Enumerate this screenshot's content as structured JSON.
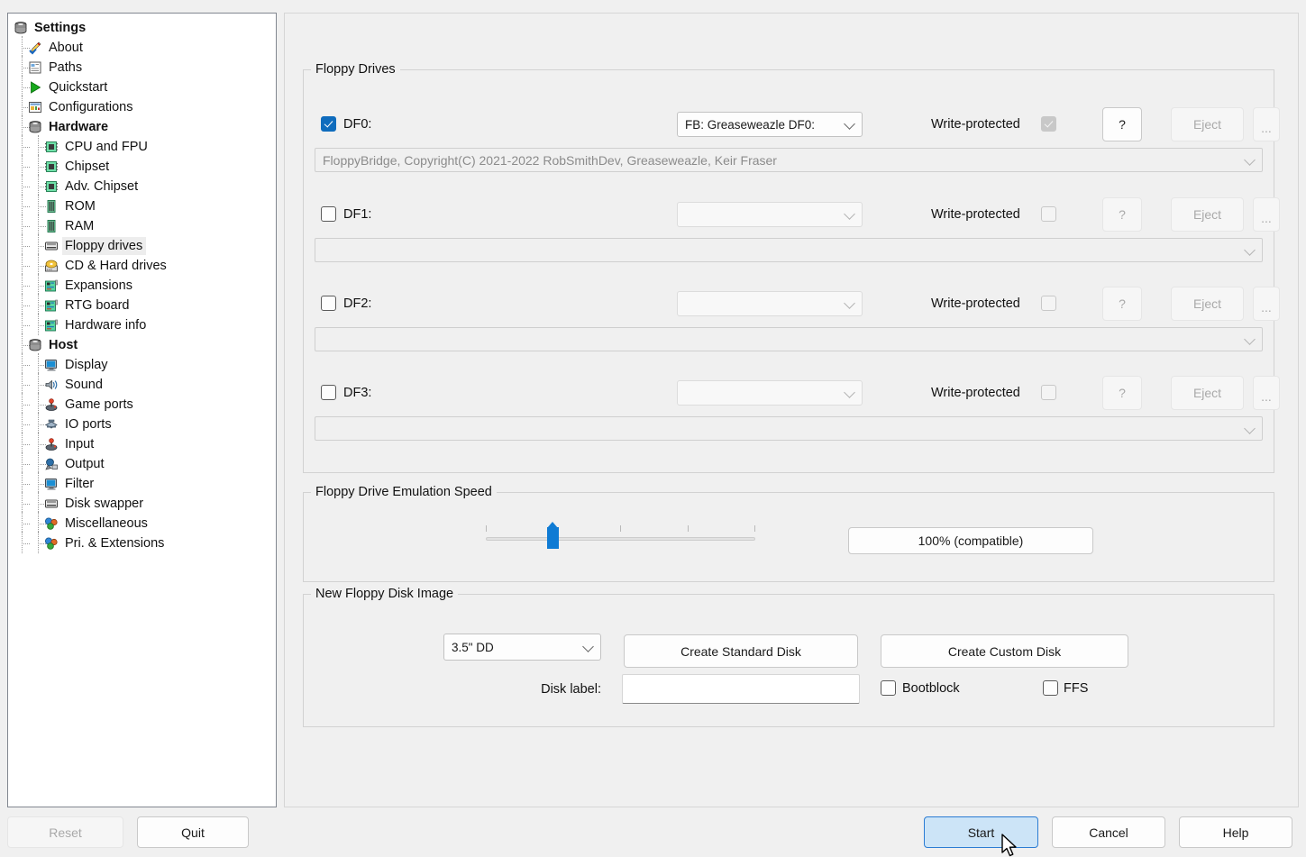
{
  "sidebar": {
    "title": "Settings",
    "items": [
      {
        "label": "Settings",
        "icon": "disk-stack-icon",
        "level": 0,
        "bold": true,
        "selected": false
      },
      {
        "label": "About",
        "icon": "pencil-icon",
        "level": 1,
        "bold": false,
        "selected": false
      },
      {
        "label": "Paths",
        "icon": "paths-icon",
        "level": 1,
        "bold": false,
        "selected": false
      },
      {
        "label": "Quickstart",
        "icon": "play-icon",
        "level": 1,
        "bold": false,
        "selected": false
      },
      {
        "label": "Configurations",
        "icon": "config-icon",
        "level": 1,
        "bold": false,
        "selected": false
      },
      {
        "label": "Hardware",
        "icon": "disk-stack-icon",
        "level": 1,
        "bold": true,
        "selected": false
      },
      {
        "label": "CPU and FPU",
        "icon": "chip-icon",
        "level": 2,
        "bold": false,
        "selected": false
      },
      {
        "label": "Chipset",
        "icon": "chip-icon",
        "level": 2,
        "bold": false,
        "selected": false
      },
      {
        "label": "Adv. Chipset",
        "icon": "chip-icon",
        "level": 2,
        "bold": false,
        "selected": false
      },
      {
        "label": "ROM",
        "icon": "memory-icon",
        "level": 2,
        "bold": false,
        "selected": false
      },
      {
        "label": "RAM",
        "icon": "memory-icon",
        "level": 2,
        "bold": false,
        "selected": false
      },
      {
        "label": "Floppy drives",
        "icon": "floppy-icon",
        "level": 2,
        "bold": false,
        "selected": true
      },
      {
        "label": "CD & Hard drives",
        "icon": "cd-hdd-icon",
        "level": 2,
        "bold": false,
        "selected": false
      },
      {
        "label": "Expansions",
        "icon": "board-icon",
        "level": 2,
        "bold": false,
        "selected": false
      },
      {
        "label": "RTG board",
        "icon": "board-icon",
        "level": 2,
        "bold": false,
        "selected": false
      },
      {
        "label": "Hardware info",
        "icon": "board-icon",
        "level": 2,
        "bold": false,
        "selected": false
      },
      {
        "label": "Host",
        "icon": "disk-stack-icon",
        "level": 1,
        "bold": true,
        "selected": false
      },
      {
        "label": "Display",
        "icon": "monitor-icon",
        "level": 2,
        "bold": false,
        "selected": false
      },
      {
        "label": "Sound",
        "icon": "sound-icon",
        "level": 2,
        "bold": false,
        "selected": false
      },
      {
        "label": "Game ports",
        "icon": "joystick-icon",
        "level": 2,
        "bold": false,
        "selected": false
      },
      {
        "label": "IO ports",
        "icon": "ioports-icon",
        "level": 2,
        "bold": false,
        "selected": false
      },
      {
        "label": "Input",
        "icon": "joystick-icon",
        "level": 2,
        "bold": false,
        "selected": false
      },
      {
        "label": "Output",
        "icon": "output-icon",
        "level": 2,
        "bold": false,
        "selected": false
      },
      {
        "label": "Filter",
        "icon": "monitor-icon",
        "level": 2,
        "bold": false,
        "selected": false
      },
      {
        "label": "Disk swapper",
        "icon": "floppy-icon",
        "level": 2,
        "bold": false,
        "selected": false
      },
      {
        "label": "Miscellaneous",
        "icon": "spheres-icon",
        "level": 2,
        "bold": false,
        "selected": false
      },
      {
        "label": "Pri. & Extensions",
        "icon": "spheres-icon",
        "level": 2,
        "bold": false,
        "selected": false
      }
    ]
  },
  "floppy_drives": {
    "group_title": "Floppy Drives",
    "write_protected_label": "Write-protected",
    "help_label": "?",
    "eject_label": "Eject",
    "browse_label": "...",
    "drives": [
      {
        "name": "DF0:",
        "enabled": true,
        "type_value": "FB: Greaseweazle DF0:",
        "path_value": "FloppyBridge, Copyright(C) 2021-2022 RobSmithDev, Greaseweazle, Keir Fraser",
        "write_protected": true,
        "write_protected_disabled": true,
        "help_enabled": true,
        "eject_enabled": false,
        "browse_enabled": false
      },
      {
        "name": "DF1:",
        "enabled": false,
        "type_value": "",
        "path_value": "",
        "write_protected": false,
        "write_protected_disabled": false,
        "help_enabled": false,
        "eject_enabled": false,
        "browse_enabled": false
      },
      {
        "name": "DF2:",
        "enabled": false,
        "type_value": "",
        "path_value": "",
        "write_protected": false,
        "write_protected_disabled": false,
        "help_enabled": false,
        "eject_enabled": false,
        "browse_enabled": false
      },
      {
        "name": "DF3:",
        "enabled": false,
        "type_value": "",
        "path_value": "",
        "write_protected": false,
        "write_protected_disabled": false,
        "help_enabled": false,
        "eject_enabled": false,
        "browse_enabled": false
      }
    ]
  },
  "emulation_speed": {
    "group_title": "Floppy Drive Emulation Speed",
    "value_label": "100% (compatible)",
    "slider_ticks": 5,
    "slider_position_index": 1,
    "slider_min": 0,
    "slider_max": 4
  },
  "new_disk_image": {
    "group_title": "New Floppy Disk Image",
    "format_value": "3.5\" DD",
    "create_standard_label": "Create Standard Disk",
    "create_custom_label": "Create Custom Disk",
    "disk_label_caption": "Disk label:",
    "disk_label_value": "",
    "bootblock_label": "Bootblock",
    "bootblock_checked": false,
    "ffs_label": "FFS",
    "ffs_checked": false
  },
  "footer": {
    "reset_label": "Reset",
    "reset_enabled": false,
    "quit_label": "Quit",
    "start_label": "Start",
    "cancel_label": "Cancel",
    "help_label": "Help"
  },
  "colors": {
    "accent": "#0f6cbd",
    "primary_button_bg": "#cce4f7",
    "primary_button_border": "#2b7cd3",
    "window_bg": "#f0f0f0",
    "selected_row": "#ededed"
  }
}
